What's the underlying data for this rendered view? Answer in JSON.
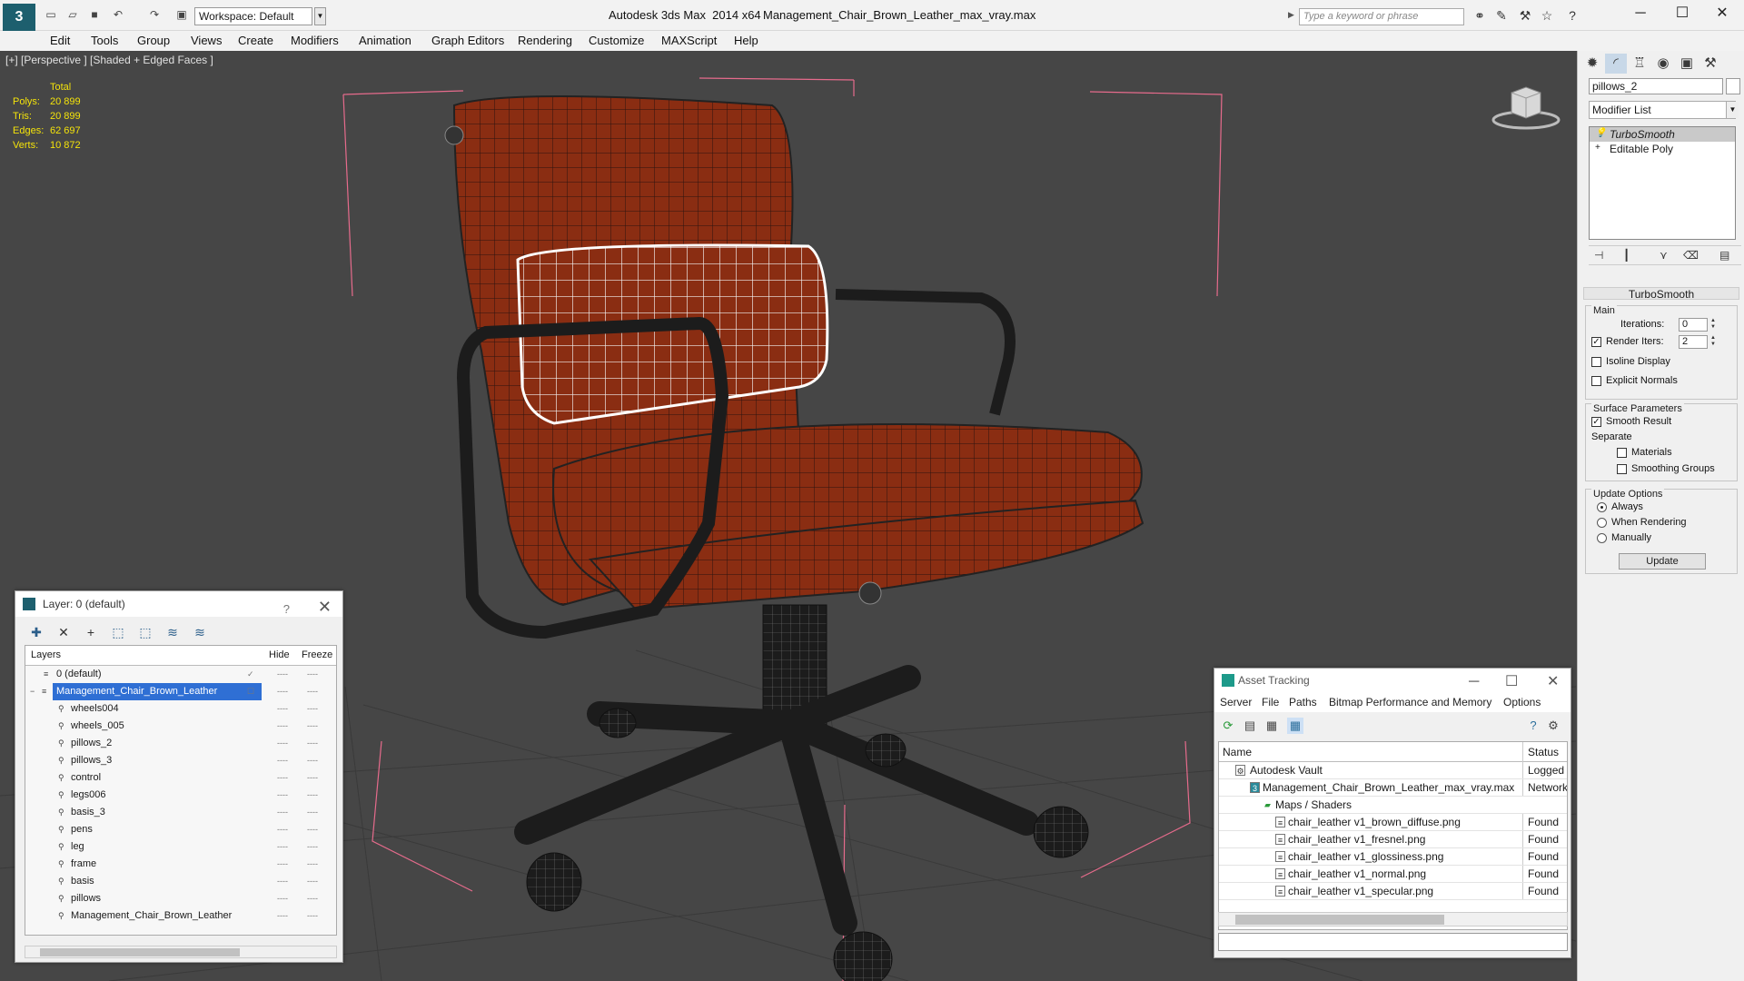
{
  "titlebar": {
    "app_title": "Autodesk 3ds Max  2014 x64",
    "file_title": "Management_Chair_Brown_Leather_max_vray.max",
    "workspace": "Workspace: Default",
    "search_placeholder": "Type a keyword or phrase"
  },
  "menu": [
    "Edit",
    "Tools",
    "Group",
    "Views",
    "Create",
    "Modifiers",
    "Animation",
    "Graph Editors",
    "Rendering",
    "Customize",
    "MAXScript",
    "Help"
  ],
  "viewport": {
    "label": "[+] [Perspective ] [Shaded + Edged Faces ]",
    "stats_header": "Total",
    "stats": [
      {
        "label": "Polys:",
        "value": "20 899"
      },
      {
        "label": "Tris:",
        "value": "20 899"
      },
      {
        "label": "Edges:",
        "value": "62 697"
      },
      {
        "label": "Verts:",
        "value": "10 872"
      }
    ],
    "stats_color": "#f4e30a",
    "chair_color": "#8a2d12",
    "selection_bracket_color": "#e66b8c"
  },
  "command_panel": {
    "object_name": "pillows_2",
    "modifier_list": "Modifier List",
    "stack": [
      "TurboSmooth",
      "Editable Poly"
    ],
    "rollout_title": "TurboSmooth",
    "main_group": "Main",
    "iterations_label": "Iterations:",
    "iterations_value": "0",
    "render_iters_label": "Render Iters:",
    "render_iters_value": "2",
    "render_iters_checked": true,
    "isoline_label": "Isoline Display",
    "explicit_normals_label": "Explicit Normals",
    "surface_group": "Surface Parameters",
    "smooth_result_label": "Smooth Result",
    "smooth_result_checked": true,
    "separate_label": "Separate",
    "materials_label": "Materials",
    "smoothing_groups_label": "Smoothing Groups",
    "update_group": "Update Options",
    "update_options": [
      "Always",
      "When Rendering",
      "Manually"
    ],
    "update_selected": "Always",
    "update_button": "Update"
  },
  "layer_window": {
    "title": "Layer: 0 (default)",
    "help": "?",
    "col_layers": "Layers",
    "col_hide": "Hide",
    "col_freeze": "Freeze",
    "hide_mark": "----",
    "freeze_mark": "----",
    "rows": [
      {
        "name": "0 (default)",
        "level": 0,
        "active": true
      },
      {
        "name": "Management_Chair_Brown_Leather",
        "level": 0,
        "selected": true
      },
      {
        "name": "wheels004",
        "level": 1
      },
      {
        "name": "wheels_005",
        "level": 1
      },
      {
        "name": "pillows_2",
        "level": 1
      },
      {
        "name": "pillows_3",
        "level": 1
      },
      {
        "name": "control",
        "level": 1
      },
      {
        "name": "legs006",
        "level": 1
      },
      {
        "name": "basis_3",
        "level": 1
      },
      {
        "name": "pens",
        "level": 1
      },
      {
        "name": "leg",
        "level": 1
      },
      {
        "name": "frame",
        "level": 1
      },
      {
        "name": "basis",
        "level": 1
      },
      {
        "name": "pillows",
        "level": 1
      },
      {
        "name": "Management_Chair_Brown_Leather",
        "level": 1
      }
    ]
  },
  "asset_window": {
    "title": "Asset Tracking",
    "menu": [
      "Server",
      "File",
      "Paths",
      "Bitmap Performance and Memory",
      "Options"
    ],
    "col_name": "Name",
    "col_status": "Status",
    "rows": [
      {
        "name": "Autodesk Vault",
        "status": "Logged Out",
        "level": 0
      },
      {
        "name": "Management_Chair_Brown_Leather_max_vray.max",
        "status": "Network",
        "level": 1
      },
      {
        "name": "Maps / Shaders",
        "status": "",
        "level": 2
      },
      {
        "name": "chair_leather v1_brown_diffuse.png",
        "status": "Found",
        "level": 3
      },
      {
        "name": "chair_leather v1_fresnel.png",
        "status": "Found",
        "level": 3
      },
      {
        "name": "chair_leather v1_glossiness.png",
        "status": "Found",
        "level": 3
      },
      {
        "name": "chair_leather v1_normal.png",
        "status": "Found",
        "level": 3
      },
      {
        "name": "chair_leather v1_specular.png",
        "status": "Found",
        "level": 3
      }
    ]
  }
}
